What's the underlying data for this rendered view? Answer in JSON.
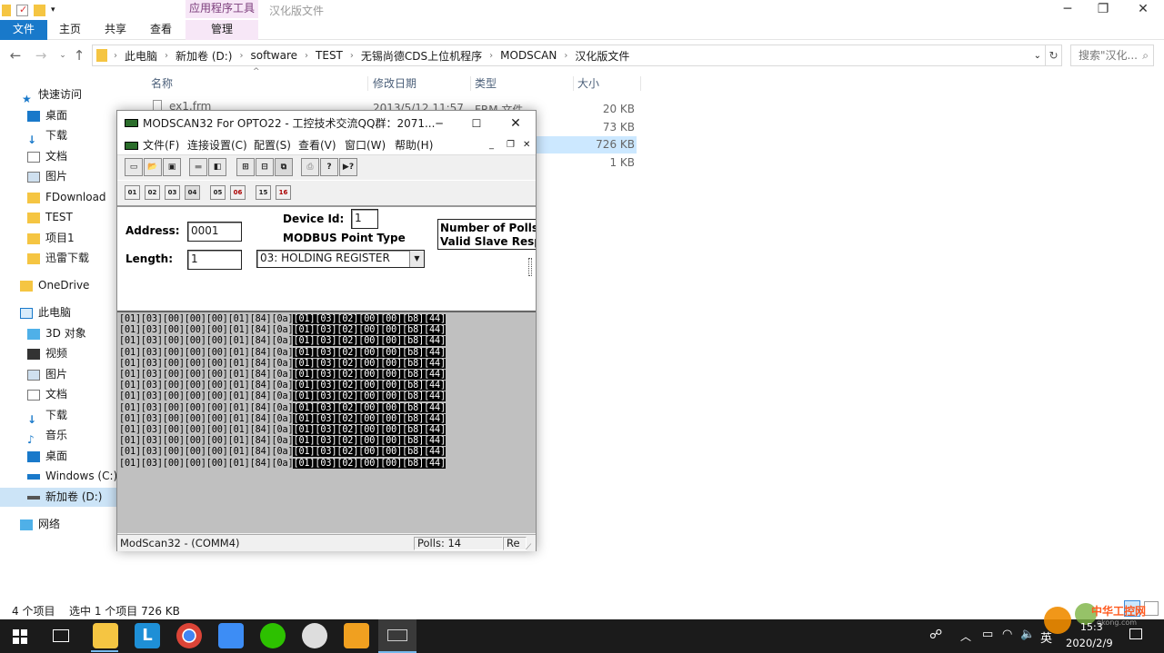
{
  "explorer": {
    "window_title": "汉化版文件",
    "context_tab_header": "应用程序工具",
    "ribbon_tabs": [
      "文件",
      "主页",
      "共享",
      "查看",
      "管理"
    ],
    "breadcrumbs": [
      "此电脑",
      "新加卷 (D:)",
      "software",
      "TEST",
      "无锡尚德CDS上位机程序",
      "MODSCAN",
      "汉化版文件"
    ],
    "search_placeholder": "搜索\"汉化...",
    "columns": {
      "name": "名称",
      "date": "修改日期",
      "type": "类型",
      "size": "大小"
    },
    "visible_file": {
      "name": "ex1.frm",
      "date": "2013/5/12 11:57",
      "type": "FRM 文件"
    },
    "sizes": [
      "20 KB",
      "73 KB",
      "726 KB",
      "1 KB"
    ],
    "nav": {
      "quick_access": "快速访问",
      "quick_items": [
        "桌面",
        "下载",
        "文档",
        "图片",
        "FDownload",
        "TEST",
        "项目1",
        "迅雷下载"
      ],
      "onedrive": "OneDrive",
      "this_pc": "此电脑",
      "pc_items": [
        "3D 对象",
        "视频",
        "图片",
        "文档",
        "下载",
        "音乐",
        "桌面",
        "Windows (C:)",
        "新加卷 (D:)"
      ],
      "network": "网络"
    },
    "status": {
      "count": "4 个项目",
      "selection": "选中 1 个项目  726 KB"
    }
  },
  "modscan": {
    "title": "MODSCAN32 For OPTO22 - 工控技术交流QQ群：2071...",
    "menus": [
      "文件(F)",
      "连接设置(C)",
      "配置(S)",
      "查看(V)",
      "窗口(W)",
      "帮助(H)"
    ],
    "toolbar2": [
      "01",
      "02",
      "03",
      "04",
      "05",
      "06",
      "15",
      "16"
    ],
    "form": {
      "address_label": "Address:",
      "address_value": "0001",
      "length_label": "Length:",
      "length_value": "1",
      "device_id_label": "Device Id:",
      "device_id_value": "1",
      "point_type_label": "MODBUS Point Type",
      "point_type_value": "03: HOLDING REGISTER",
      "polls_label": "Number of Polls:",
      "valid_label": "Valid Slave Resp"
    },
    "tx_frame": "[01][03][00][00][00][01][84][0a]",
    "rx_frame": "[01][03][02][00][00][b8][44]",
    "frame_rows": 14,
    "status": {
      "port": "ModScan32 - (COMM4)",
      "polls": "Polls: 14",
      "re": "Re"
    }
  },
  "taskbar": {
    "ime": "英",
    "time": "15:3",
    "date": "2020/2/9",
    "watermark": "中华工控网",
    "watermark_url": "gkong.com"
  }
}
